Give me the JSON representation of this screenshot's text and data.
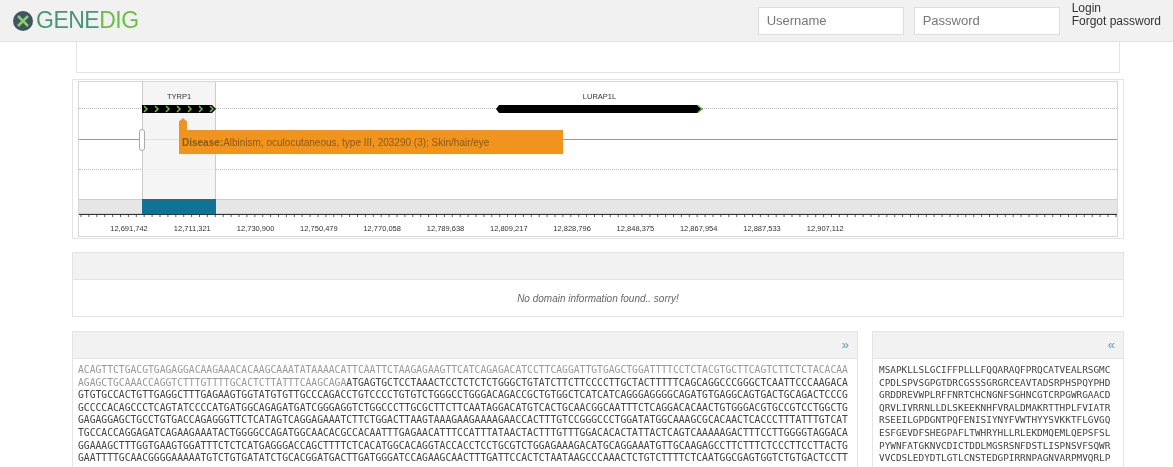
{
  "header": {
    "logo_parts": [
      "GENE",
      "DIG"
    ],
    "username": {
      "placeholder": "Username"
    },
    "password": {
      "placeholder": "Password"
    },
    "login": "Login",
    "forgot": "Forgot password"
  },
  "browser": {
    "genes": [
      {
        "label": "TYRP1",
        "kind": "chevron",
        "selected": true
      },
      {
        "label": "LURAP1L",
        "kind": "solid",
        "selected": false
      }
    ],
    "tooltip": {
      "label": "Disease:",
      "text": "Albinism, oculocutaneous, type III, 203290 (3); Skin/hair/eye"
    },
    "ruler": [
      "12,691,742",
      "12,711,321",
      "12,730,900",
      "12,750,479",
      "12,770,058",
      "12,789,638",
      "12,809,217",
      "12,828,796",
      "12,848,375",
      "12,867,954",
      "12,887,533",
      "12,907,112"
    ]
  },
  "domains": {
    "message": "No domain information found.. sorry!"
  },
  "sequence": {
    "toggle": "»",
    "lines": [
      [
        {
          "kind": "utr",
          "text": "ACAGTTCTGACGTGAGAGGACAAGAAACACAAGCAAATATAAAACATTCAATTCTAAGAGAAGTTCATCAGAGACATCCTTCAGGATTGTGAGCTGGATTTTCCTCTACGTGCTTCAGTCTTCTCTACACAA"
        }
      ],
      [
        {
          "kind": "utr",
          "text": "AGAGCTGCAAACCAGGTCTTTGTTTTGCACTCTTATTTCAAGCAGA"
        },
        {
          "kind": "cds",
          "text": "ATGAGTGCTCCTAAACTCCTCTCTCTGGGCTGTATCTTCTTCCCCTTGCTACTTTTTCAGCAGGCCCGGGCTCAATTCCCAAGACA"
        }
      ],
      [
        {
          "kind": "cds",
          "text": "GTGTGCCACTGTTGAGGCTTTGAGAAGTGGTATGTGTTGCCCAGACCTGTCCCCTGTGTCTGGGCCTGGGACAGACCGCTGTGGCTCATCATCAGGGAGGGGCAGATGTGAGGCAGTGACTGCAGACTCCCG"
        }
      ],
      [
        {
          "kind": "cds",
          "text": "GCCCCACAGCCCTCAGTATCCCCATGATGGCAGAGATGATCGGGAGGTCTGGCCCTTGCGCTTCTTCAATAGGACATGTCACTGCAACGGCAATTTCTCAGGACACAACTGTGGGACGTGCCGTCCTGGCTG"
        }
      ],
      [
        {
          "kind": "cds",
          "text": "GAGAGGAGCTGCCTGTGACCAGAGGGTTCTCATAGTCAGGAGAAATCTTCTGGACTTAAGTAAAGAAGAAAAGAACCACTTTGTCCGGGCCCTGGATATGGCAAAGCGCACAACTCACCCTTTATTTGTCAT"
        }
      ],
      [
        {
          "kind": "cds",
          "text": "TGCCACCAGGAGATCAGAAGAAATACTGGGGCCAGATGGCAACACGCCACAATTTGAGAACATTTCCATTTATAACTACTTTGTTTGGACACACTATTACTCAGTCAAAAAGACTTTCCTTGGGGTAGGACA"
        }
      ],
      [
        {
          "kind": "cds",
          "text": "GGAAAGCTTTGGTGAAGTGGATTTCTCTCATGAGGGACCAGCTTTTCTCACATGGCACAGGTACCACCTCCTGCGTCTGGAGAAAGACATGCAGGAAATGTTGCAAGAGCCTTCTTTCTCCCTTCCTTACTG"
        }
      ],
      [
        {
          "kind": "cds",
          "text": "GAATTTTGCAACGGGGAAAAATGTCTGTGATATCTGCACGGATGACTTGATGGGATCCAGAAGCAACTTTGATTCCACTCTAATAAGCCCAAACTCTGTCTTTTCTCAATGGCGAGTGGTCTGTGACTCCTT"
        }
      ]
    ]
  },
  "protein": {
    "toggle": "«",
    "lines": [
      "MSAPKLLSLGCIFFPLLLFQQARAQFPRQCATVEALRSGMC",
      "CPDLSPVSGPGTDRCGSSSGRGRCEAVTADSRPHSPQYPHD",
      "GRDDREVWPLRFFNRTCHCNGNFSGHNCGTCRPGWRGAACD",
      "QRVLIVRRNLLDLSKEEKNHFVRALDMAKRTTHPLFVIATR",
      "RSEEILGPDGNTPQFENISIYNYFVWTHYYSVKKTFLGVGQ",
      "ESFGEVDFSHEGPAFLTWHRYHLLRLEKDMQEMLQEPSFSL",
      "PYWNFATGKNVCDICTDDLMGSRSNFDSTLISPNSVFSQWR",
      "VVCDSLEDYDTLGTLCNSTEDGPIRRNPAGNVARPMVQRLP"
    ]
  }
}
